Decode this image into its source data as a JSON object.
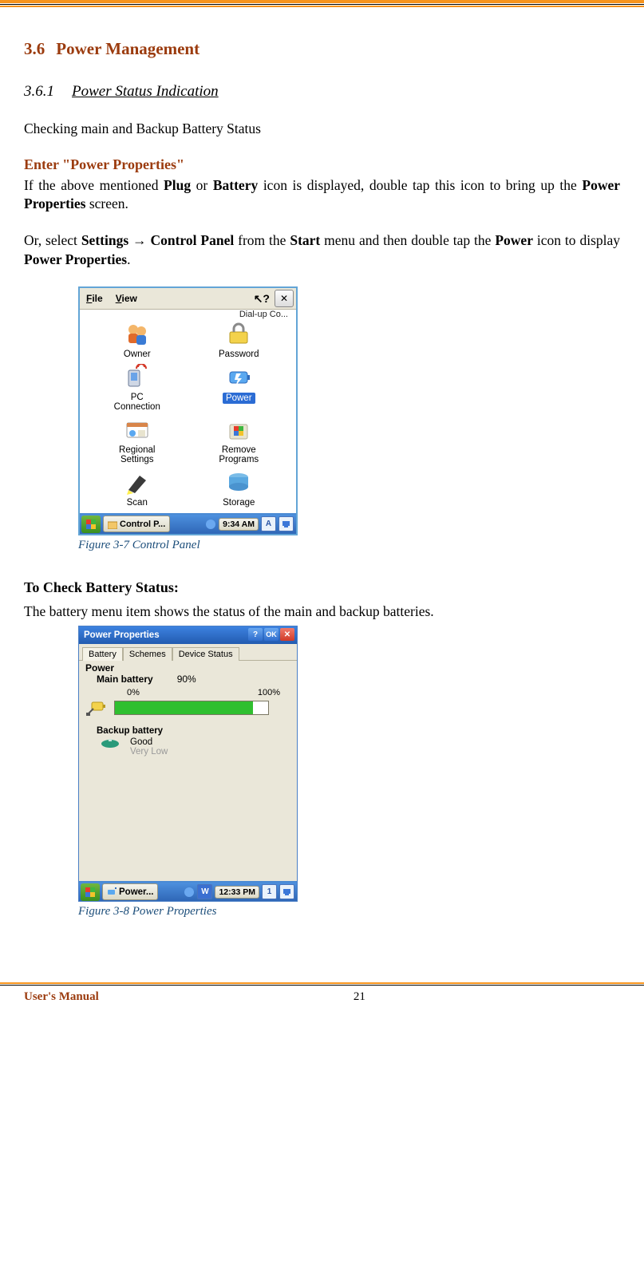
{
  "section": {
    "number": "3.6",
    "title": "Power Management"
  },
  "subsection": {
    "number": "3.6.1",
    "title": "Power Status Indication"
  },
  "intro": "Checking main and Backup Battery Status",
  "step1_title": "Enter \"Power Properties\"",
  "p1": {
    "a": "If the above mentioned ",
    "plug": "Plug",
    "b": " or ",
    "battery": "Battery",
    "c": " icon is displayed, double tap this icon to bring up the ",
    "pp": "Power Properties",
    "d": " screen."
  },
  "p2": {
    "a": "Or, select ",
    "settings": "Settings",
    "arrow": " → ",
    "cp": "Control Panel",
    "b": " from the ",
    "start": "Start",
    "c": " menu and then double tap the ",
    "power": "Power",
    "d": " icon to display ",
    "pp": "Power Properties",
    "e": "."
  },
  "fig1_caption": "Figure 3-7 Control Panel",
  "cp_screenshot": {
    "menu_file": "File",
    "menu_view": "View",
    "hint": "Dial-up Co...",
    "items": [
      {
        "label": "Owner"
      },
      {
        "label": "Password"
      },
      {
        "label": "PC\nConnection"
      },
      {
        "label": "Power",
        "selected": true
      },
      {
        "label": "Regional\nSettings"
      },
      {
        "label": "Remove\nPrograms"
      },
      {
        "label": "Scan"
      },
      {
        "label": "Storage"
      }
    ],
    "task_label": "Control P...",
    "time": "9:34 AM",
    "tray_letter": "A"
  },
  "mid_heading": "To Check Battery Status:",
  "mid_para": "The battery menu item shows the status of the main and backup batteries.",
  "pp_screenshot": {
    "title": "Power Properties",
    "tabs": [
      "Battery",
      "Schemes",
      "Device Status"
    ],
    "group": "Power",
    "main_label": "Main battery",
    "main_pct": "90%",
    "scale_min": "0%",
    "scale_max": "100%",
    "main_fill_pct": 90,
    "backup_label": "Backup battery",
    "backup_good": "Good",
    "backup_verylow": "Very Low",
    "task_label": "Power...",
    "time": "12:33 PM",
    "tray_letter": "1"
  },
  "fig2_caption": "Figure 3-8 Power Properties",
  "footer": {
    "title": "User's Manual",
    "page": "21"
  }
}
